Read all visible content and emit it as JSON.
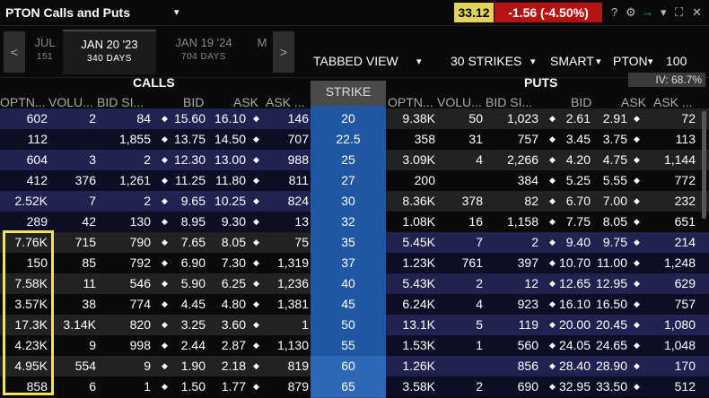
{
  "title": {
    "symbol": "PTON",
    "view": "Calls and Puts",
    "caret": "▾"
  },
  "quote": {
    "last": "33.12",
    "change": "-1.56 (-4.50%)"
  },
  "toolbar_icons": {
    "help": "?",
    "settings": "⚙",
    "link": "🔗",
    "caret": "▾",
    "expand": "⛶",
    "close": "✕"
  },
  "expiries": {
    "prev_arrow": "<",
    "next_arrow": ">",
    "tabs": [
      {
        "date": "JUL",
        "days": "151"
      },
      {
        "date": "JAN 20 '23",
        "days": "340 DAYS"
      },
      {
        "date": "JAN 19 '24",
        "days": "704 DAYS"
      },
      {
        "date": "M",
        "days": ""
      }
    ]
  },
  "controls": {
    "view": "TABBED VIEW",
    "view_caret": "▾",
    "strikes": "30 STRIKES",
    "strikes_caret": "▾",
    "exchange": "SMART",
    "exchange_caret": "▾",
    "symbol": "PTON",
    "symbol_caret": "▾",
    "quantity": "100"
  },
  "sections": {
    "calls": "CALLS",
    "puts": "PUTS",
    "iv": "IV: 68.7%",
    "strike": "STRIKE"
  },
  "headers": {
    "calls": {
      "oi": "OPTN...",
      "vol": "VOLU...",
      "bid_size": "BID SI...",
      "bid": "BID",
      "ask": "ASK",
      "ask_size": "ASK ..."
    },
    "puts": {
      "oi": "OPTN...",
      "vol": "VOLU...",
      "bid_size": "BID SI...",
      "bid": "BID",
      "ask": "ASK",
      "ask_size": "ASK ..."
    }
  },
  "rows": [
    {
      "strike": "20",
      "c_oi": "602",
      "c_vol": "2",
      "c_bsz": "84",
      "c_bid": "15.60",
      "c_ask": "16.10",
      "c_asz": "146",
      "p_oi": "9.38K",
      "p_vol": "50",
      "p_bsz": "1,023",
      "p_bid": "2.61",
      "p_ask": "2.91",
      "p_asz": "72"
    },
    {
      "strike": "22.5",
      "c_oi": "112",
      "c_vol": "",
      "c_bsz": "1,855",
      "c_bid": "13.75",
      "c_ask": "14.50",
      "c_asz": "707",
      "p_oi": "358",
      "p_vol": "31",
      "p_bsz": "757",
      "p_bid": "3.45",
      "p_ask": "3.75",
      "p_asz": "113"
    },
    {
      "strike": "25",
      "c_oi": "604",
      "c_vol": "3",
      "c_bsz": "2",
      "c_bid": "12.30",
      "c_ask": "13.00",
      "c_asz": "988",
      "p_oi": "3.09K",
      "p_vol": "4",
      "p_bsz": "2,266",
      "p_bid": "4.20",
      "p_ask": "4.75",
      "p_asz": "1,144"
    },
    {
      "strike": "27",
      "c_oi": "412",
      "c_vol": "376",
      "c_bsz": "1,261",
      "c_bid": "11.25",
      "c_ask": "11.80",
      "c_asz": "811",
      "p_oi": "200",
      "p_vol": "",
      "p_bsz": "384",
      "p_bid": "5.25",
      "p_ask": "5.55",
      "p_asz": "772"
    },
    {
      "strike": "30",
      "c_oi": "2.52K",
      "c_vol": "7",
      "c_bsz": "2",
      "c_bid": "9.65",
      "c_ask": "10.25",
      "c_asz": "824",
      "p_oi": "8.36K",
      "p_vol": "378",
      "p_bsz": "82",
      "p_bid": "6.70",
      "p_ask": "7.00",
      "p_asz": "232"
    },
    {
      "strike": "32",
      "c_oi": "289",
      "c_vol": "42",
      "c_bsz": "130",
      "c_bid": "8.95",
      "c_ask": "9.30",
      "c_asz": "13",
      "p_oi": "1.08K",
      "p_vol": "16",
      "p_bsz": "1,158",
      "p_bid": "7.75",
      "p_ask": "8.05",
      "p_asz": "651"
    },
    {
      "strike": "35",
      "c_oi": "7.76K",
      "c_vol": "715",
      "c_bsz": "790",
      "c_bid": "7.65",
      "c_ask": "8.05",
      "c_asz": "75",
      "p_oi": "5.45K",
      "p_vol": "7",
      "p_bsz": "2",
      "p_bid": "9.40",
      "p_ask": "9.75",
      "p_asz": "214"
    },
    {
      "strike": "37",
      "c_oi": "150",
      "c_vol": "85",
      "c_bsz": "792",
      "c_bid": "6.90",
      "c_ask": "7.30",
      "c_asz": "1,319",
      "p_oi": "1.23K",
      "p_vol": "761",
      "p_bsz": "397",
      "p_bid": "10.70",
      "p_ask": "11.00",
      "p_asz": "1,248"
    },
    {
      "strike": "40",
      "c_oi": "7.58K",
      "c_vol": "11",
      "c_bsz": "546",
      "c_bid": "5.90",
      "c_ask": "6.25",
      "c_asz": "1,236",
      "p_oi": "5.43K",
      "p_vol": "2",
      "p_bsz": "12",
      "p_bid": "12.65",
      "p_ask": "12.95",
      "p_asz": "629"
    },
    {
      "strike": "45",
      "c_oi": "3.57K",
      "c_vol": "38",
      "c_bsz": "774",
      "c_bid": "4.45",
      "c_ask": "4.80",
      "c_asz": "1,381",
      "p_oi": "6.24K",
      "p_vol": "4",
      "p_bsz": "923",
      "p_bid": "16.10",
      "p_ask": "16.50",
      "p_asz": "757"
    },
    {
      "strike": "50",
      "c_oi": "17.3K",
      "c_vol": "3.14K",
      "c_bsz": "820",
      "c_bid": "3.25",
      "c_ask": "3.60",
      "c_asz": "1",
      "p_oi": "13.1K",
      "p_vol": "5",
      "p_bsz": "119",
      "p_bid": "20.00",
      "p_ask": "20.45",
      "p_asz": "1,080"
    },
    {
      "strike": "55",
      "c_oi": "4.23K",
      "c_vol": "9",
      "c_bsz": "998",
      "c_bid": "2.44",
      "c_ask": "2.87",
      "c_asz": "1,130",
      "p_oi": "1.53K",
      "p_vol": "1",
      "p_bsz": "560",
      "p_bid": "24.05",
      "p_ask": "24.65",
      "p_asz": "1,048"
    },
    {
      "strike": "60",
      "c_oi": "4.95K",
      "c_vol": "554",
      "c_bsz": "9",
      "c_bid": "1.90",
      "c_ask": "2.18",
      "c_asz": "819",
      "p_oi": "1.26K",
      "p_vol": "",
      "p_bsz": "856",
      "p_bid": "28.40",
      "p_ask": "28.90",
      "p_asz": "170"
    },
    {
      "strike": "65",
      "c_oi": "858",
      "c_vol": "6",
      "c_bsz": "1",
      "c_bid": "1.50",
      "c_ask": "1.77",
      "c_asz": "879",
      "p_oi": "3.58K",
      "p_vol": "2",
      "p_bsz": "690",
      "p_bid": "32.95",
      "p_ask": "33.50",
      "p_asz": "512"
    }
  ],
  "colors": {
    "call_itm_even": "#222251",
    "call_itm_odd": "#0d0d26",
    "call_otm_even": "#222222",
    "call_otm_odd": "#0a0a0a",
    "put_itm_even": "#222251",
    "put_itm_odd": "#0d0d26",
    "put_otm_even": "#222222",
    "put_otm_odd": "#0a0a0a",
    "strike": "#1f57a3",
    "last_price_bg": "#e2d35c",
    "change_bg": "#b41414",
    "highlight_border": "#f2e35a"
  },
  "itm_call_rows": 6
}
